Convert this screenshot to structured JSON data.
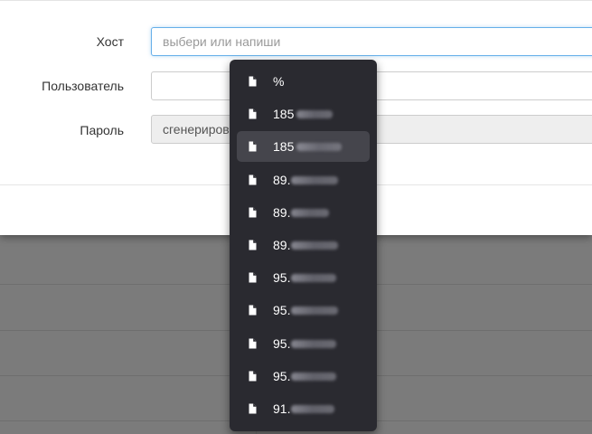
{
  "form": {
    "host": {
      "label": "Хост",
      "placeholder": "выбери или напиши",
      "value": ""
    },
    "user": {
      "label": "Пользователь",
      "value": ""
    },
    "password": {
      "label": "Пароль",
      "value": "сгенериров"
    }
  },
  "dropdown": {
    "items": [
      {
        "text": "%",
        "icon": "file-icon",
        "hovered": false
      },
      {
        "text": "185",
        "icon": "file-icon",
        "hovered": false
      },
      {
        "text": "185",
        "icon": "file-icon",
        "hovered": true
      },
      {
        "text": "89.",
        "icon": "file-icon",
        "hovered": false
      },
      {
        "text": "89.",
        "icon": "file-icon",
        "hovered": false
      },
      {
        "text": "89.",
        "icon": "file-icon",
        "hovered": false
      },
      {
        "text": "95.",
        "icon": "file-icon",
        "hovered": false
      },
      {
        "text": "95.",
        "icon": "file-icon",
        "hovered": false
      },
      {
        "text": "95.",
        "icon": "file-icon",
        "hovered": false
      },
      {
        "text": "95.",
        "icon": "file-icon",
        "hovered": false
      },
      {
        "text": "91.",
        "icon": "file-icon",
        "hovered": false
      }
    ]
  },
  "colors": {
    "focus": "#66afe9",
    "dropdown_bg": "#2a2a30",
    "hover_bg": "#45454c"
  }
}
